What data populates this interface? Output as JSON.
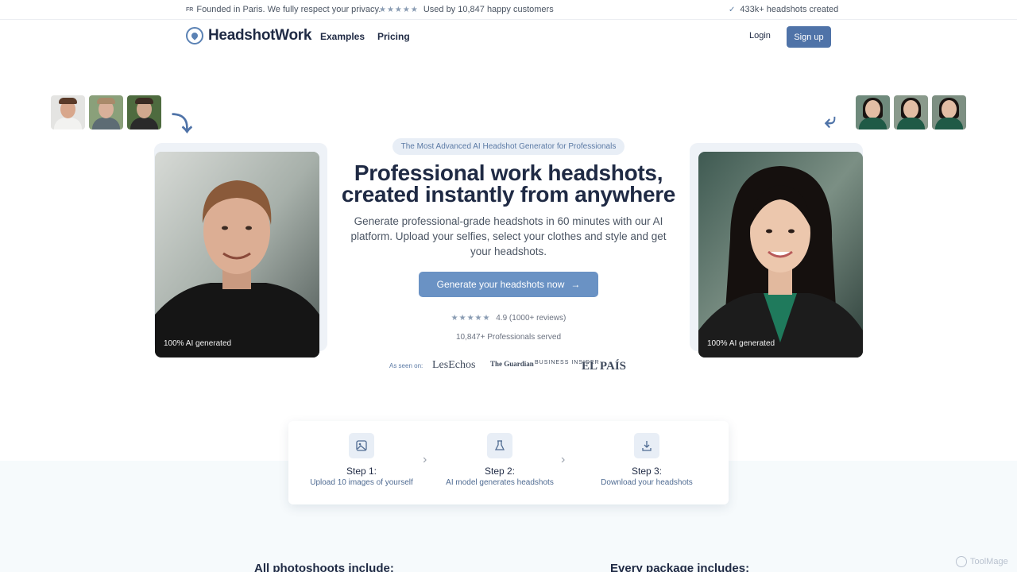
{
  "topbar": {
    "flag_label": "FR",
    "founded_text": "Founded in Paris. We fully respect your privacy.",
    "stars": "★★★★★",
    "customers_text": "Used by 10,847 happy customers",
    "check": "✓",
    "headshots_text": "433k+ headshots created"
  },
  "nav": {
    "logo_text": "HeadshotWork",
    "examples": "Examples",
    "pricing": "Pricing",
    "login": "Login",
    "signup": "Sign up"
  },
  "hero": {
    "pill": "The Most Advanced AI Headshot Generator for Professionals",
    "headline_line1": "Professional work headshots,",
    "headline_line2": "created instantly from anywhere",
    "subtext": "Generate professional-grade headshots in 60 minutes with our AI platform. Upload your selfies, select your clothes and style and get your headshots.",
    "cta": "Generate your headshots now",
    "cta_arrow": "→",
    "rating_stars": "★★★★★",
    "rating_text": "4.9 (1000+ reviews)",
    "served": "10,847+ Professionals served",
    "photo_caption_left": "100% AI generated",
    "photo_caption_right": "100% AI generated"
  },
  "press": {
    "label": "As seen on:",
    "logos": [
      "LesEchos",
      "The Guardian",
      "BUSINESS INSIDER",
      "EL PAÍS"
    ]
  },
  "steps": [
    {
      "title": "Step 1:",
      "desc": "Upload 10 images of yourself",
      "icon": "image-icon"
    },
    {
      "title": "Step 2:",
      "desc": "AI model generates headshots",
      "icon": "flask-icon"
    },
    {
      "title": "Step 3:",
      "desc": "Download your headshots",
      "icon": "download-icon"
    }
  ],
  "bottom": {
    "left_heading": "All photoshoots include:",
    "right_heading": "Every package includes:"
  },
  "watermark": "ToolMage",
  "colors": {
    "brand": "#4f73a8",
    "cta": "#6a92c4",
    "text": "#1f2a44"
  }
}
